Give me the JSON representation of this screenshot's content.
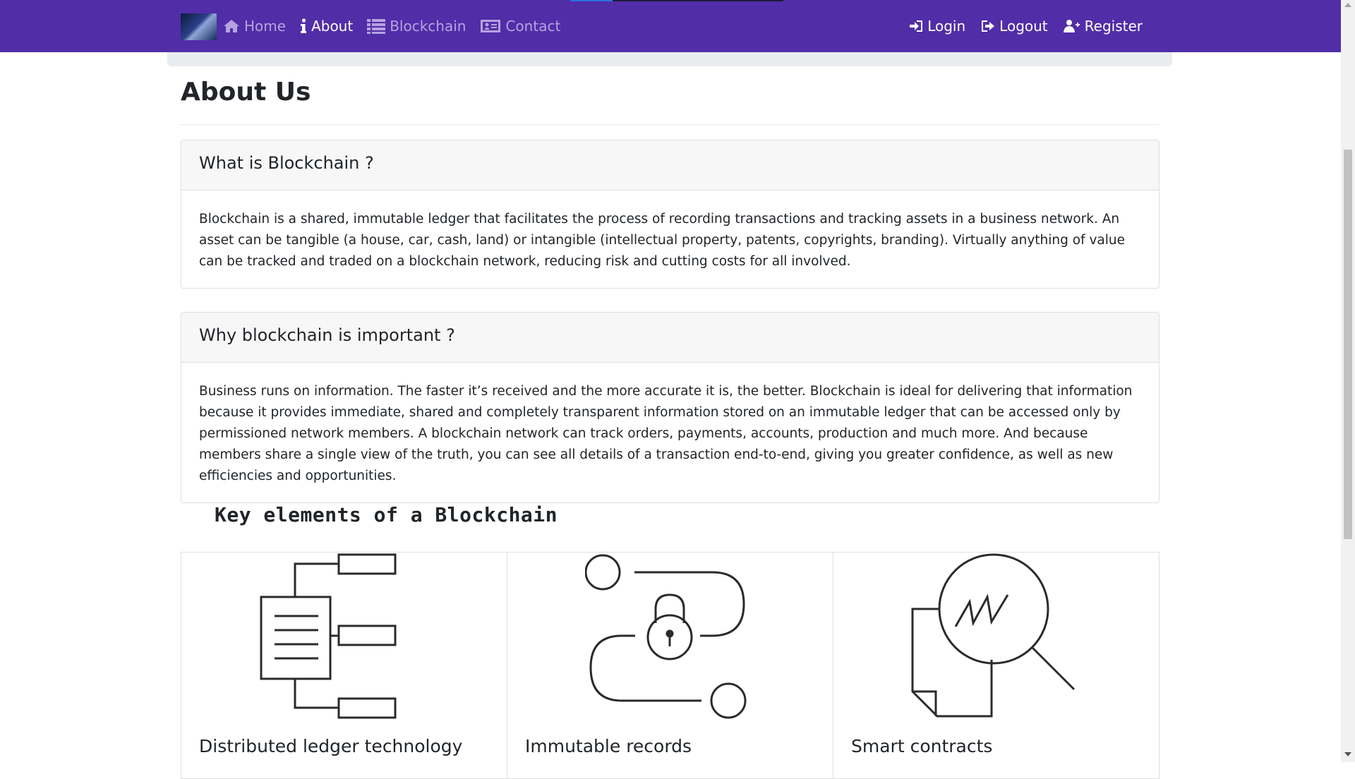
{
  "nav": {
    "left": [
      {
        "label": "Home",
        "icon": "home-icon",
        "active": false
      },
      {
        "label": "About",
        "icon": "info-icon",
        "active": true
      },
      {
        "label": "Blockchain",
        "icon": "list-icon",
        "active": false
      },
      {
        "label": "Contact",
        "icon": "contact-card-icon",
        "active": false
      }
    ],
    "right": [
      {
        "label": "Login",
        "icon": "login-icon"
      },
      {
        "label": "Logout",
        "icon": "logout-icon"
      },
      {
        "label": "Register",
        "icon": "user-plus-icon"
      }
    ]
  },
  "page": {
    "title": "About Us"
  },
  "cards": [
    {
      "header": "What is Blockchain ?",
      "body": "Blockchain is a shared, immutable ledger that facilitates the process of recording transactions and tracking assets in a business network. An asset can be tangible (a house, car, cash, land) or intangible (intellectual property, patents, copyrights, branding). Virtually anything of value can be tracked and traded on a blockchain network, reducing risk and cutting costs for all involved."
    },
    {
      "header": "Why blockchain is important ?",
      "body": "Business runs on information. The faster it’s received and the more accurate it is, the better. Blockchain is ideal for delivering that information because it provides immediate, shared and completely transparent information stored on an immutable ledger that can be accessed only by permissioned network members. A blockchain network can track orders, payments, accounts, production and much more. And because members share a single view of the truth, you can see all details of a transaction end-to-end, giving you greater confidence, as well as new efficiencies and opportunities."
    }
  ],
  "key_elements": {
    "title": "Key elements of a Blockchain",
    "items": [
      {
        "label": "Distributed ledger technology",
        "icon": "distributed-ledger-icon"
      },
      {
        "label": "Immutable records",
        "icon": "immutable-records-lock-icon"
      },
      {
        "label": "Smart contracts",
        "icon": "smart-contract-magnifier-icon"
      }
    ]
  },
  "colors": {
    "navbar": "#512da8",
    "nav_inactive": "#b5a3df",
    "nav_active": "#ffffff"
  }
}
